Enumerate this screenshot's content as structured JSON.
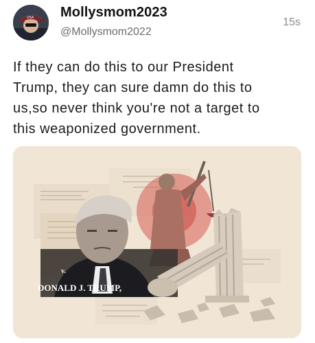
{
  "post": {
    "display_name": "Mollysmom2023",
    "handle": "@Mollysmom2022",
    "timestamp": "15s",
    "text": "If they can do this to our President\nTrump, they can sure damn do this to\nus,so never think you're not a target to\nthis weaponized government."
  },
  "media": {
    "versus_label": "v.",
    "defendant_name": "DONALD J. TRUMP,"
  },
  "colors": {
    "background": "#ffffff",
    "name_text": "#111111",
    "secondary_text": "#6b6b6b",
    "media_background": "#f1e6d6",
    "accent_red": "#c94a44"
  },
  "icons": {
    "avatar": "profile-photo",
    "justice": "lady-justice-statue",
    "column": "broken-column"
  }
}
